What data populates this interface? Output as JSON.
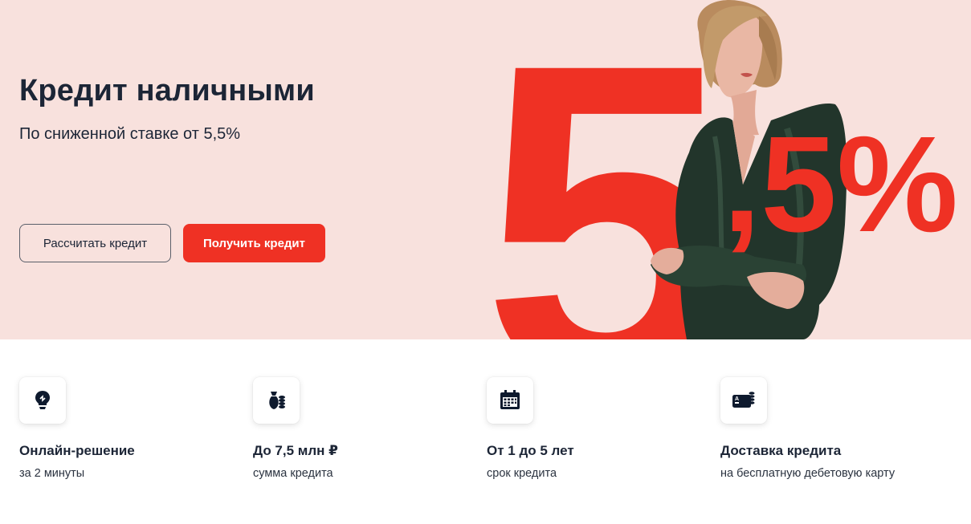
{
  "hero": {
    "title": "Кредит наличными",
    "subtitle": "По сниженной ставке от 5,5%",
    "calc_button": "Рассчитать кредит",
    "get_button": "Получить кредит",
    "promo_big_digit": "5",
    "promo_rest": ",5%"
  },
  "features": [
    {
      "icon": "lightbulb-icon",
      "title": "Онлайн-решение",
      "desc": "за 2 минуты"
    },
    {
      "icon": "money-bag-icon",
      "title": "До 7,5 млн ₽",
      "desc": "сумма кредита"
    },
    {
      "icon": "calendar-icon",
      "title": "От 1 до 5 лет",
      "desc": "срок кредита"
    },
    {
      "icon": "card-coins-icon",
      "title": "Доставка кредита",
      "desc": "на бесплатную дебетовую карту"
    }
  ],
  "colors": {
    "hero_bg": "#f8e1dd",
    "brand_red": "#ef3124",
    "text_dark": "#1c2536",
    "icon_dark": "#0e1a2e"
  }
}
